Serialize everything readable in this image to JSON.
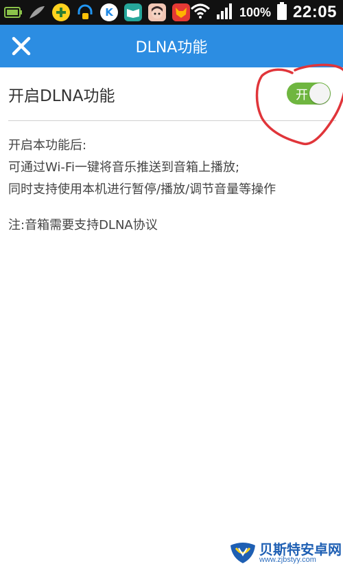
{
  "status_bar": {
    "battery_percent": "100%",
    "time": "22:05",
    "app_icons": [
      "battery-charge-icon",
      "feather-icon",
      "plus-app-icon",
      "headset-app-icon",
      "k-app-icon",
      "book-app-icon",
      "avatar-app-icon",
      "fox-app-icon"
    ]
  },
  "header": {
    "title": "DLNA功能",
    "close_icon": "close-icon"
  },
  "setting": {
    "label": "开启DLNA功能",
    "toggle_label": "开",
    "toggle_on": true
  },
  "description": {
    "line1": "开启本功能后:",
    "line2": "可通过Wi-Fi一键将音乐推送到音箱上播放;",
    "line3": "同时支持使用本机进行暂停/播放/调节音量等操作",
    "note": "注:音箱需要支持DLNA协议"
  },
  "watermark": {
    "name": "贝斯特安卓网",
    "url": "www.zjbstyy.com"
  },
  "colors": {
    "header_bg": "#2c8de2",
    "toggle_on": "#6fb640",
    "annotation": "#e0353a"
  }
}
